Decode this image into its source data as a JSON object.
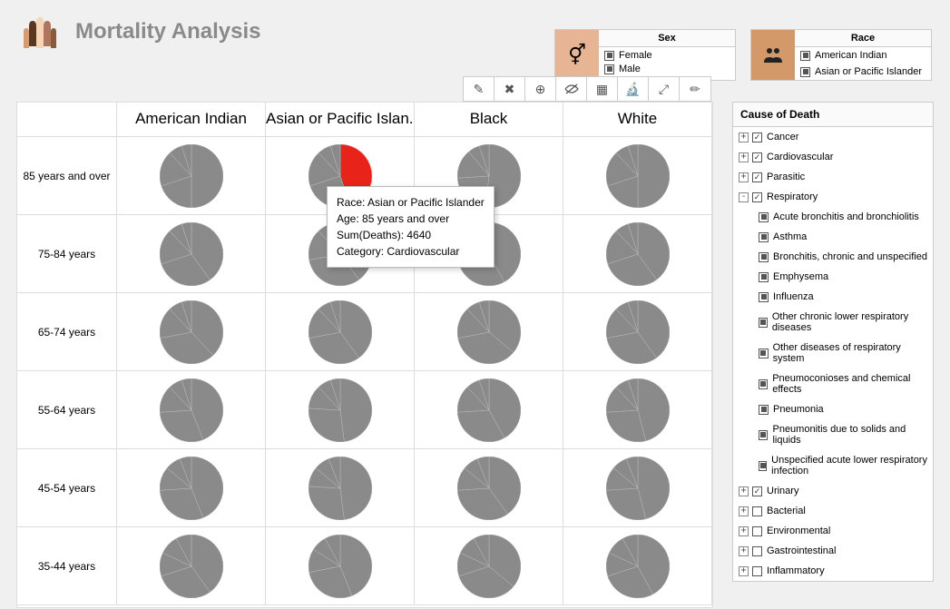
{
  "title": "Mortality Analysis",
  "filters": {
    "sex": {
      "header": "Sex",
      "items": [
        "Female",
        "Male"
      ]
    },
    "race": {
      "header": "Race",
      "items": [
        "American Indian",
        "Asian or Pacific Islander"
      ]
    }
  },
  "grid": {
    "columns": [
      "American Indian",
      "Asian or Pacific Islan..",
      "Black",
      "White"
    ],
    "rows": [
      "85 years and over",
      "75-84 years",
      "65-74 years",
      "55-64 years",
      "45-54 years",
      "35-44 years"
    ]
  },
  "tooltip": {
    "line1": "Race: Asian or Pacific Islander",
    "line2": "Age: 85 years and over",
    "line3": "Sum(Deaths): 4640",
    "line4": "Category: Cardiovascular"
  },
  "sidebar": {
    "header": "Cause of Death",
    "tree": [
      {
        "label": "Cancer",
        "expand": "+",
        "checked": true
      },
      {
        "label": "Cardiovascular",
        "expand": "+",
        "checked": true
      },
      {
        "label": "Parasitic",
        "expand": "+",
        "checked": true
      },
      {
        "label": "Respiratory",
        "expand": "-",
        "checked": true,
        "children": [
          "Acute bronchitis and bronchiolitis",
          "Asthma",
          "Bronchitis, chronic and unspecified",
          "Emphysema",
          "Influenza",
          "Other chronic lower respiratory diseases",
          "Other diseases of respiratory system",
          "Pneumoconioses and chemical effects",
          "Pneumonia",
          "Pneumonitis due to solids and liquids",
          "Unspecified acute lower respiratory infection"
        ]
      },
      {
        "label": "Urinary",
        "expand": "+",
        "checked": true
      },
      {
        "label": "Bacterial",
        "expand": "+",
        "checked": false
      },
      {
        "label": "Environmental",
        "expand": "+",
        "checked": false
      },
      {
        "label": "Gastrointestinal",
        "expand": "+",
        "checked": false
      },
      {
        "label": "Inflammatory",
        "expand": "+",
        "checked": false
      }
    ]
  },
  "chart_data": {
    "type": "pie",
    "description": "Small-multiples pie chart grid: rows are age groups, columns are race groups, each pie shows distribution of deaths by cause-of-death category.",
    "row_facets": [
      "85 years and over",
      "75-84 years",
      "65-74 years",
      "55-64 years",
      "45-54 years",
      "35-44 years"
    ],
    "column_facets": [
      "American Indian",
      "Asian or Pacific Islander",
      "Black",
      "White"
    ],
    "slice_categories": [
      "Cancer",
      "Cardiovascular",
      "Parasitic",
      "Respiratory",
      "Urinary"
    ],
    "highlighted_slice": {
      "row": "85 years and over",
      "column": "Asian or Pacific Islander",
      "category": "Cardiovascular",
      "sum_deaths": 4640,
      "approx_share": 0.45
    },
    "cells": [
      {
        "row": "85 years and over",
        "col": "American Indian",
        "slices": [
          {
            "cat": "Cardiovascular",
            "share": 0.5
          },
          {
            "cat": "Cancer",
            "share": 0.2
          },
          {
            "cat": "Respiratory",
            "share": 0.18
          },
          {
            "cat": "Urinary",
            "share": 0.07
          },
          {
            "cat": "Parasitic",
            "share": 0.05
          }
        ]
      },
      {
        "row": "85 years and over",
        "col": "Asian or Pacific Islander",
        "slices": [
          {
            "cat": "Cardiovascular",
            "share": 0.45,
            "deaths": 4640
          },
          {
            "cat": "Cancer",
            "share": 0.25
          },
          {
            "cat": "Respiratory",
            "share": 0.18
          },
          {
            "cat": "Urinary",
            "share": 0.07
          },
          {
            "cat": "Parasitic",
            "share": 0.05
          }
        ]
      },
      {
        "row": "85 years and over",
        "col": "Black",
        "slices": [
          {
            "cat": "Cardiovascular",
            "share": 0.52
          },
          {
            "cat": "Cancer",
            "share": 0.22
          },
          {
            "cat": "Respiratory",
            "share": 0.15
          },
          {
            "cat": "Urinary",
            "share": 0.06
          },
          {
            "cat": "Parasitic",
            "share": 0.05
          }
        ]
      },
      {
        "row": "85 years and over",
        "col": "White",
        "slices": [
          {
            "cat": "Cardiovascular",
            "share": 0.5
          },
          {
            "cat": "Cancer",
            "share": 0.2
          },
          {
            "cat": "Respiratory",
            "share": 0.18
          },
          {
            "cat": "Urinary",
            "share": 0.07
          },
          {
            "cat": "Parasitic",
            "share": 0.05
          }
        ]
      },
      {
        "row": "75-84 years",
        "col": "American Indian",
        "slices": [
          {
            "cat": "Cardiovascular",
            "share": 0.4
          },
          {
            "cat": "Cancer",
            "share": 0.3
          },
          {
            "cat": "Respiratory",
            "share": 0.18
          },
          {
            "cat": "Urinary",
            "share": 0.07
          },
          {
            "cat": "Parasitic",
            "share": 0.05
          }
        ]
      },
      {
        "row": "75-84 years",
        "col": "Asian or Pacific Islander",
        "slices": [
          {
            "cat": "Cardiovascular",
            "share": 0.4
          },
          {
            "cat": "Cancer",
            "share": 0.32
          },
          {
            "cat": "Respiratory",
            "share": 0.16
          },
          {
            "cat": "Urinary",
            "share": 0.07
          },
          {
            "cat": "Parasitic",
            "share": 0.05
          }
        ]
      },
      {
        "row": "75-84 years",
        "col": "Black",
        "slices": [
          {
            "cat": "Cardiovascular",
            "share": 0.42
          },
          {
            "cat": "Cancer",
            "share": 0.3
          },
          {
            "cat": "Respiratory",
            "share": 0.16
          },
          {
            "cat": "Urinary",
            "share": 0.07
          },
          {
            "cat": "Parasitic",
            "share": 0.05
          }
        ]
      },
      {
        "row": "75-84 years",
        "col": "White",
        "slices": [
          {
            "cat": "Cardiovascular",
            "share": 0.4
          },
          {
            "cat": "Cancer",
            "share": 0.3
          },
          {
            "cat": "Respiratory",
            "share": 0.18
          },
          {
            "cat": "Urinary",
            "share": 0.07
          },
          {
            "cat": "Parasitic",
            "share": 0.05
          }
        ]
      },
      {
        "row": "65-74 years",
        "col": "American Indian",
        "slices": [
          {
            "cat": "Cancer",
            "share": 0.38
          },
          {
            "cat": "Cardiovascular",
            "share": 0.34
          },
          {
            "cat": "Respiratory",
            "share": 0.16
          },
          {
            "cat": "Urinary",
            "share": 0.07
          },
          {
            "cat": "Parasitic",
            "share": 0.05
          }
        ]
      },
      {
        "row": "65-74 years",
        "col": "Asian or Pacific Islander",
        "slices": [
          {
            "cat": "Cancer",
            "share": 0.4
          },
          {
            "cat": "Cardiovascular",
            "share": 0.32
          },
          {
            "cat": "Respiratory",
            "share": 0.16
          },
          {
            "cat": "Urinary",
            "share": 0.07
          },
          {
            "cat": "Parasitic",
            "share": 0.05
          }
        ]
      },
      {
        "row": "65-74 years",
        "col": "Black",
        "slices": [
          {
            "cat": "Cancer",
            "share": 0.36
          },
          {
            "cat": "Cardiovascular",
            "share": 0.36
          },
          {
            "cat": "Respiratory",
            "share": 0.16
          },
          {
            "cat": "Urinary",
            "share": 0.07
          },
          {
            "cat": "Parasitic",
            "share": 0.05
          }
        ]
      },
      {
        "row": "65-74 years",
        "col": "White",
        "slices": [
          {
            "cat": "Cancer",
            "share": 0.4
          },
          {
            "cat": "Cardiovascular",
            "share": 0.32
          },
          {
            "cat": "Respiratory",
            "share": 0.16
          },
          {
            "cat": "Urinary",
            "share": 0.07
          },
          {
            "cat": "Parasitic",
            "share": 0.05
          }
        ]
      },
      {
        "row": "55-64 years",
        "col": "American Indian",
        "slices": [
          {
            "cat": "Cancer",
            "share": 0.44
          },
          {
            "cat": "Cardiovascular",
            "share": 0.3
          },
          {
            "cat": "Respiratory",
            "share": 0.14
          },
          {
            "cat": "Urinary",
            "share": 0.07
          },
          {
            "cat": "Parasitic",
            "share": 0.05
          }
        ]
      },
      {
        "row": "55-64 years",
        "col": "Asian or Pacific Islander",
        "slices": [
          {
            "cat": "Cancer",
            "share": 0.48
          },
          {
            "cat": "Cardiovascular",
            "share": 0.28
          },
          {
            "cat": "Respiratory",
            "share": 0.12
          },
          {
            "cat": "Urinary",
            "share": 0.07
          },
          {
            "cat": "Parasitic",
            "share": 0.05
          }
        ]
      },
      {
        "row": "55-64 years",
        "col": "Black",
        "slices": [
          {
            "cat": "Cancer",
            "share": 0.42
          },
          {
            "cat": "Cardiovascular",
            "share": 0.32
          },
          {
            "cat": "Respiratory",
            "share": 0.14
          },
          {
            "cat": "Urinary",
            "share": 0.07
          },
          {
            "cat": "Parasitic",
            "share": 0.05
          }
        ]
      },
      {
        "row": "55-64 years",
        "col": "White",
        "slices": [
          {
            "cat": "Cancer",
            "share": 0.46
          },
          {
            "cat": "Cardiovascular",
            "share": 0.28
          },
          {
            "cat": "Respiratory",
            "share": 0.14
          },
          {
            "cat": "Urinary",
            "share": 0.07
          },
          {
            "cat": "Parasitic",
            "share": 0.05
          }
        ]
      },
      {
        "row": "45-54 years",
        "col": "American Indian",
        "slices": [
          {
            "cat": "Cancer",
            "share": 0.44
          },
          {
            "cat": "Cardiovascular",
            "share": 0.3
          },
          {
            "cat": "Respiratory",
            "share": 0.12
          },
          {
            "cat": "Urinary",
            "share": 0.08
          },
          {
            "cat": "Parasitic",
            "share": 0.06
          }
        ]
      },
      {
        "row": "45-54 years",
        "col": "Asian or Pacific Islander",
        "slices": [
          {
            "cat": "Cancer",
            "share": 0.48
          },
          {
            "cat": "Cardiovascular",
            "share": 0.28
          },
          {
            "cat": "Respiratory",
            "share": 0.1
          },
          {
            "cat": "Urinary",
            "share": 0.08
          },
          {
            "cat": "Parasitic",
            "share": 0.06
          }
        ]
      },
      {
        "row": "45-54 years",
        "col": "Black",
        "slices": [
          {
            "cat": "Cancer",
            "share": 0.4
          },
          {
            "cat": "Cardiovascular",
            "share": 0.34
          },
          {
            "cat": "Respiratory",
            "share": 0.12
          },
          {
            "cat": "Urinary",
            "share": 0.08
          },
          {
            "cat": "Parasitic",
            "share": 0.06
          }
        ]
      },
      {
        "row": "45-54 years",
        "col": "White",
        "slices": [
          {
            "cat": "Cancer",
            "share": 0.46
          },
          {
            "cat": "Cardiovascular",
            "share": 0.28
          },
          {
            "cat": "Respiratory",
            "share": 0.12
          },
          {
            "cat": "Urinary",
            "share": 0.08
          },
          {
            "cat": "Parasitic",
            "share": 0.06
          }
        ]
      },
      {
        "row": "35-44 years",
        "col": "American Indian",
        "slices": [
          {
            "cat": "Cancer",
            "share": 0.4
          },
          {
            "cat": "Cardiovascular",
            "share": 0.3
          },
          {
            "cat": "Respiratory",
            "share": 0.12
          },
          {
            "cat": "Parasitic",
            "share": 0.1
          },
          {
            "cat": "Urinary",
            "share": 0.08
          }
        ]
      },
      {
        "row": "35-44 years",
        "col": "Asian or Pacific Islander",
        "slices": [
          {
            "cat": "Cancer",
            "share": 0.44
          },
          {
            "cat": "Cardiovascular",
            "share": 0.28
          },
          {
            "cat": "Respiratory",
            "share": 0.12
          },
          {
            "cat": "Parasitic",
            "share": 0.08
          },
          {
            "cat": "Urinary",
            "share": 0.08
          }
        ]
      },
      {
        "row": "35-44 years",
        "col": "Black",
        "slices": [
          {
            "cat": "Cancer",
            "share": 0.36
          },
          {
            "cat": "Cardiovascular",
            "share": 0.34
          },
          {
            "cat": "Respiratory",
            "share": 0.12
          },
          {
            "cat": "Parasitic",
            "share": 0.1
          },
          {
            "cat": "Urinary",
            "share": 0.08
          }
        ]
      },
      {
        "row": "35-44 years",
        "col": "White",
        "slices": [
          {
            "cat": "Cancer",
            "share": 0.42
          },
          {
            "cat": "Cardiovascular",
            "share": 0.28
          },
          {
            "cat": "Respiratory",
            "share": 0.12
          },
          {
            "cat": "Parasitic",
            "share": 0.1
          },
          {
            "cat": "Urinary",
            "share": 0.08
          }
        ]
      }
    ]
  }
}
